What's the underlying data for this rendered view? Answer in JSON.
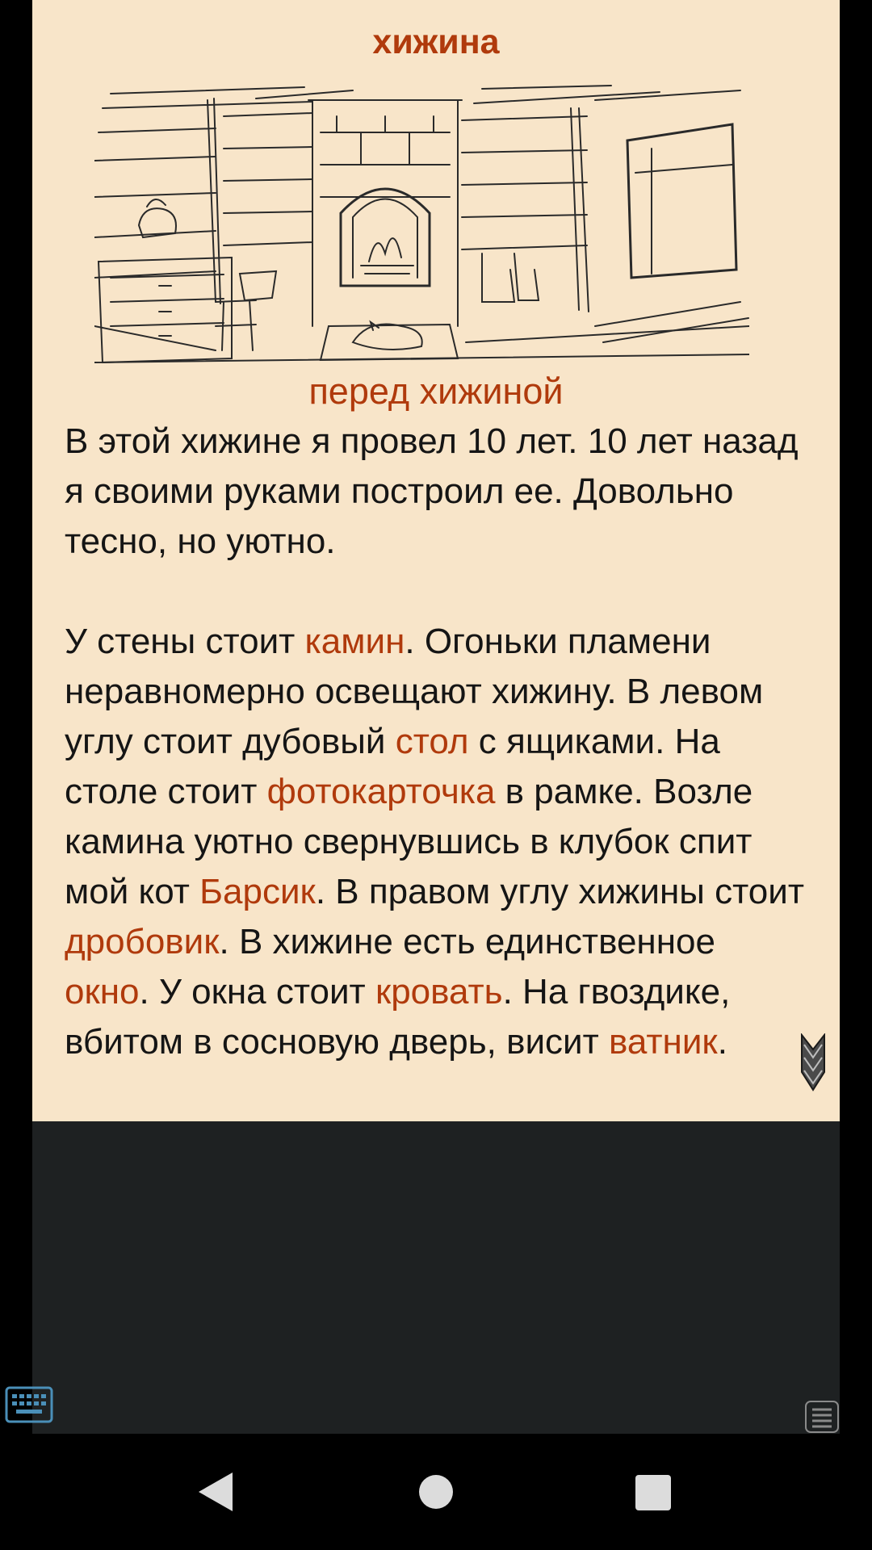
{
  "room": {
    "title": "хижина",
    "illustration_alt": "cabin-interior-sketch",
    "location_link": "перед хижиной"
  },
  "story": {
    "paragraph1": "В этой хижине я провел 10 лет. 10 лет назад я своими руками построил ее. Довольно тесно, но уютно.",
    "p2": {
      "t1": "У стены стоит ",
      "link_fireplace": "камин",
      "t2": ". Огоньки пламени неравномерно освещают хижину. В левом углу стоит дубовый ",
      "link_table": "стол",
      "t3": " с ящиками. На столе стоит ",
      "link_photo": "фотокарточка",
      "t4": " в рамке. Возле камина уютно свернувшись в клубок спит мой кот ",
      "link_cat": "Барсик",
      "t5": ". В правом углу хижины стоит ",
      "link_shotgun": "дробовик",
      "t6": ". В хижине есть единственное ",
      "link_window": "окно",
      "t7": ". У окна стоит ",
      "link_bed": "кровать",
      "t8": ". На гвоздике, вбитом в сосновую дверь, висит ",
      "link_jacket": "ватник",
      "t9": "."
    }
  },
  "icons": {
    "scroll": "chevron-down-icon",
    "keyboard": "keyboard-icon",
    "menu": "menu-icon",
    "back": "back-triangle-icon",
    "home": "home-circle-icon",
    "recent": "recent-square-icon"
  },
  "colors": {
    "page_background": "#f8e5c9",
    "link": "#b03a0c",
    "text": "#151515",
    "screen_background": "#1e2122"
  }
}
